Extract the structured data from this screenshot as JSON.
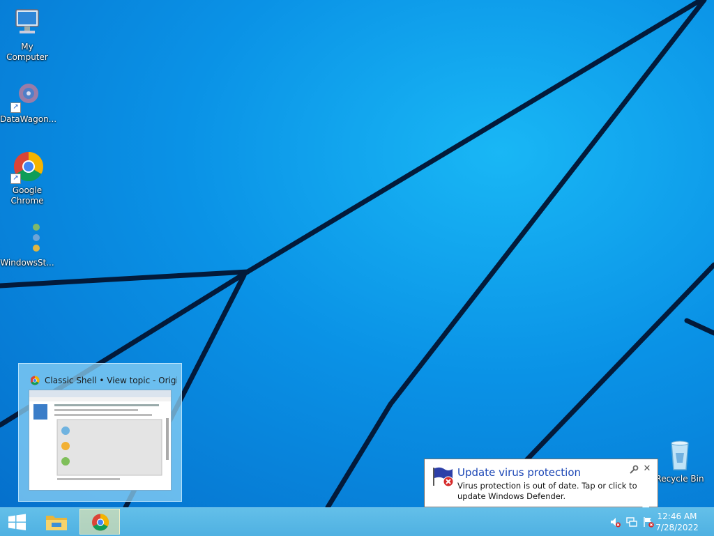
{
  "desktop": {
    "icons": [
      {
        "label": "My Computer"
      },
      {
        "label": "DataWagon..."
      },
      {
        "label": "Google Chrome"
      },
      {
        "label": "WindowsSt..."
      },
      {
        "label": "Recycle Bin"
      }
    ]
  },
  "preview": {
    "title": "Classic Shell • View topic - Origi..."
  },
  "notification": {
    "title": "Update virus protection",
    "body": "Virus protection is out of date. Tap or click to update Windows Defender."
  },
  "taskbar": {
    "clock_time": "12:46 AM",
    "clock_date": "7/28/2022",
    "apps": [
      {
        "icon": "file-explorer-icon",
        "active": false
      },
      {
        "icon": "chrome-icon",
        "active": true
      }
    ]
  },
  "colors": {
    "accent": "#0a92e6",
    "taskbar": "#55b7e6",
    "notification_title": "#1b46b5"
  }
}
